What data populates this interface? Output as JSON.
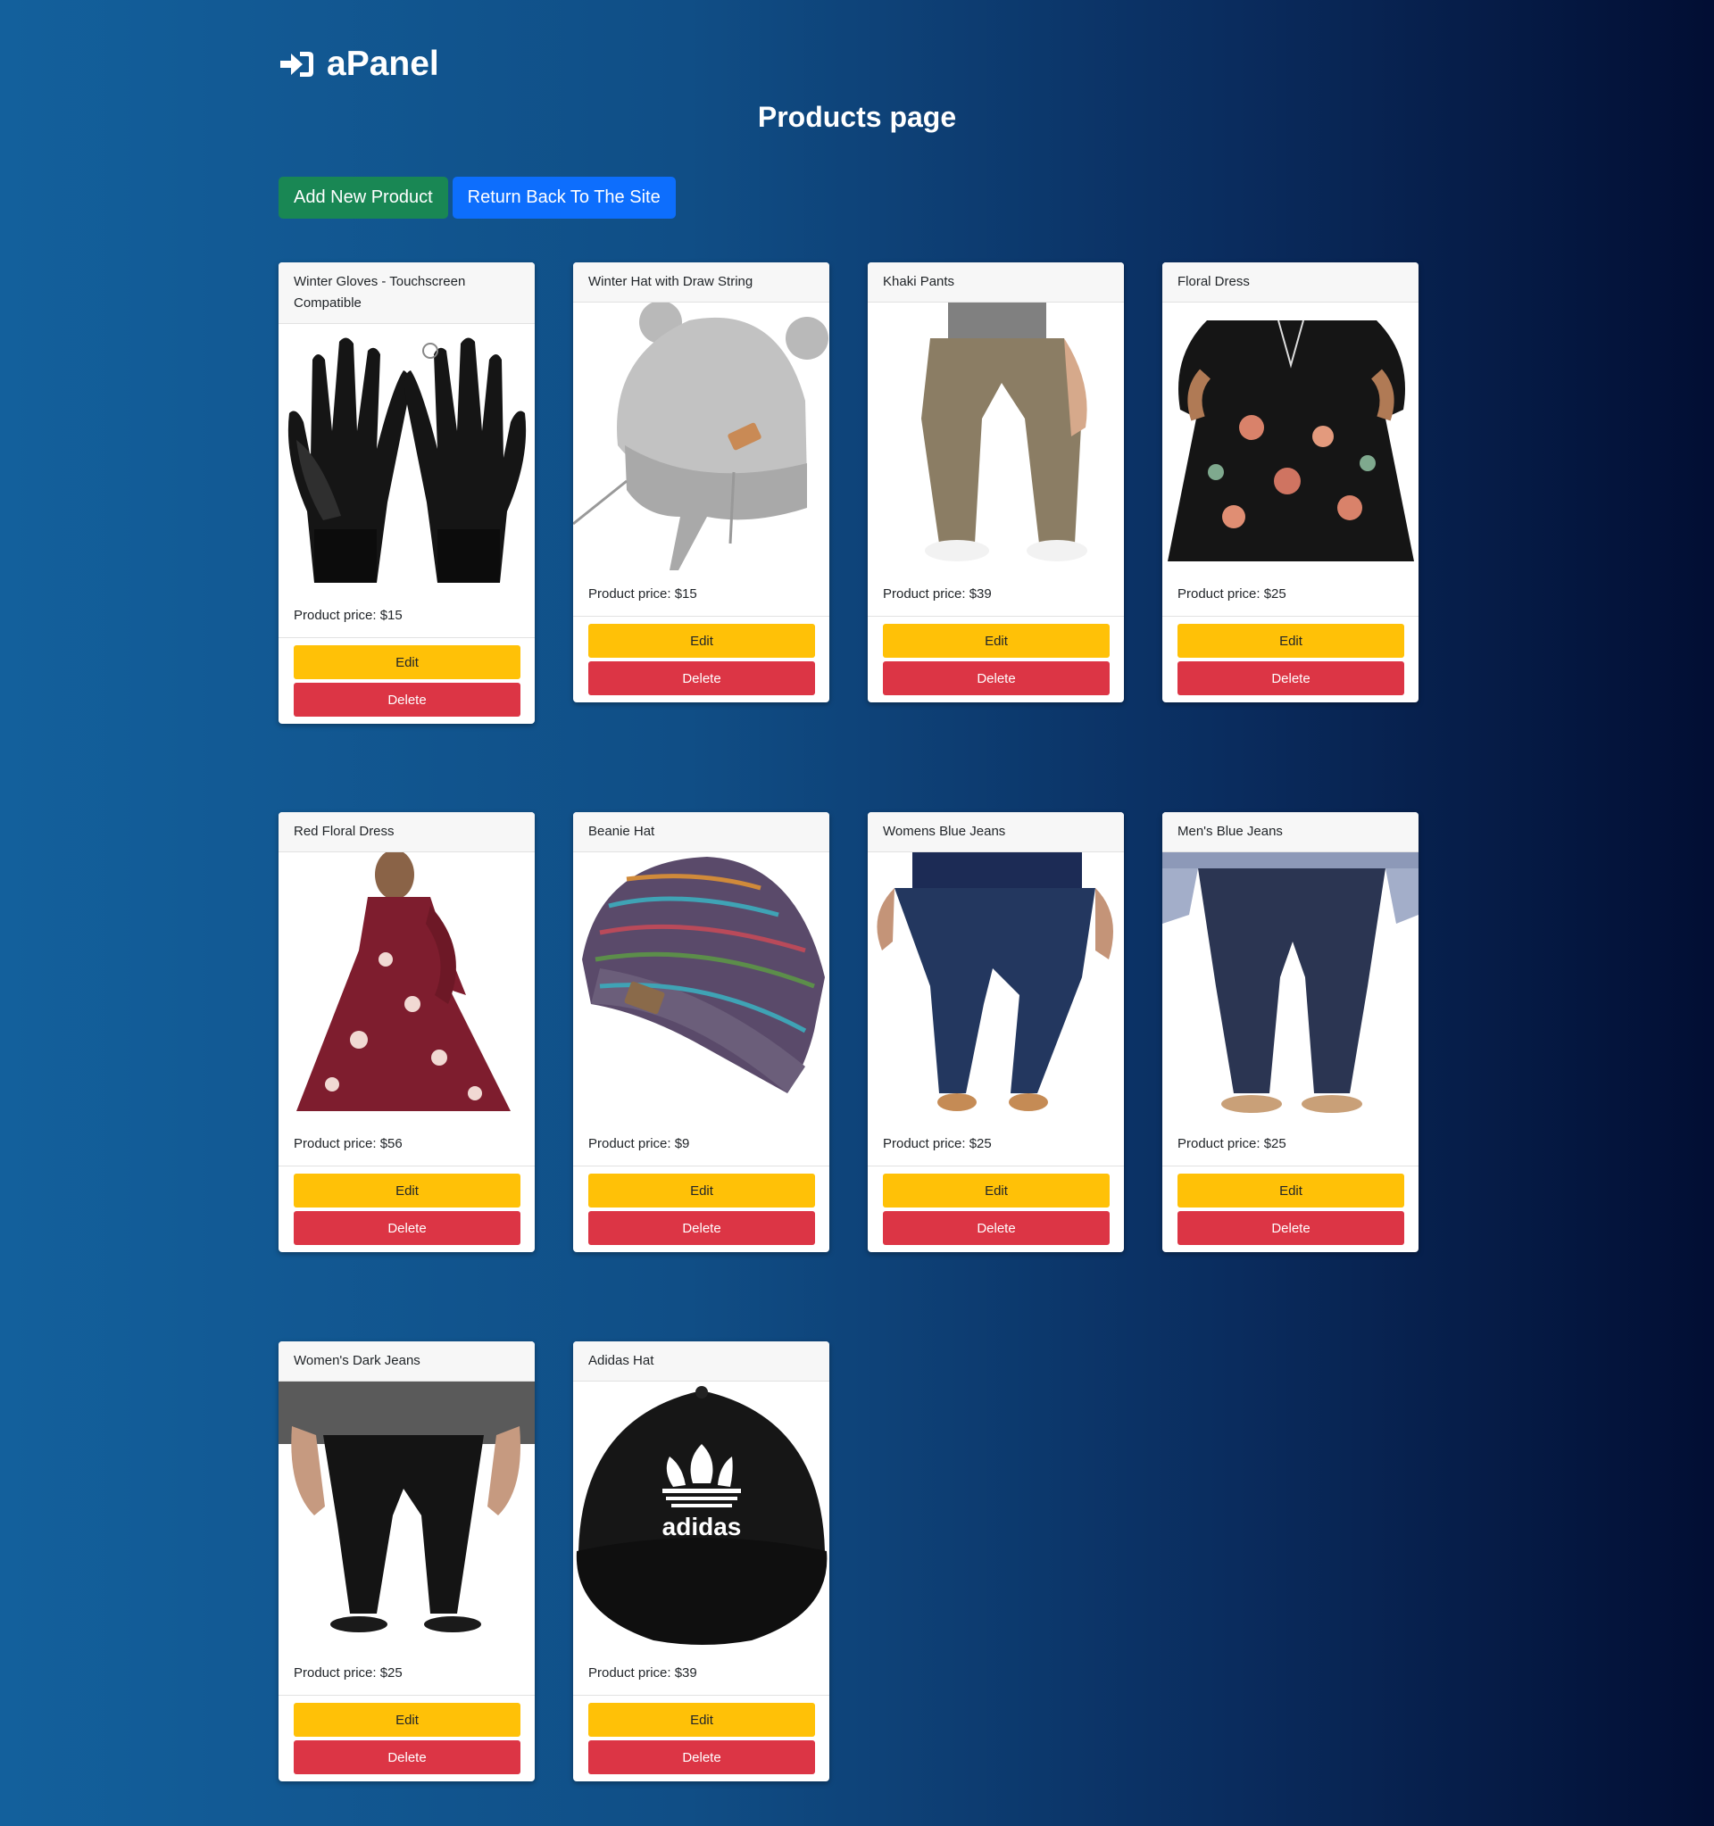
{
  "brand": {
    "icon": "sign-in-icon",
    "name": "aPanel"
  },
  "page": {
    "title": "Products page"
  },
  "toolbar": {
    "add_label": "Add New Product",
    "return_label": "Return Back To The Site"
  },
  "colors": {
    "add": "#198754",
    "return": "#0d6efd",
    "edit": "#ffc107",
    "delete": "#dc3545"
  },
  "products": [
    {
      "name": "Winter Gloves - Touchscreen Compatible",
      "price": "Product price: $15",
      "edit": "Edit",
      "delete": "Delete",
      "image": "black-winter-gloves"
    },
    {
      "name": "Winter Hat with Draw String",
      "price": "Product price: $15",
      "edit": "Edit",
      "delete": "Delete",
      "image": "grey-knit-hat"
    },
    {
      "name": "Khaki Pants",
      "price": "Product price: $39",
      "edit": "Edit",
      "delete": "Delete",
      "image": "khaki-pants"
    },
    {
      "name": "Floral Dress",
      "price": "Product price: $25",
      "edit": "Edit",
      "delete": "Delete",
      "image": "black-floral-dress"
    },
    {
      "name": "Red Floral Dress",
      "price": "Product price: $56",
      "edit": "Edit",
      "delete": "Delete",
      "image": "red-floral-dress"
    },
    {
      "name": "Beanie Hat",
      "price": "Product price: $9",
      "edit": "Edit",
      "delete": "Delete",
      "image": "multicolor-beanie"
    },
    {
      "name": "Womens Blue Jeans",
      "price": "Product price: $25",
      "edit": "Edit",
      "delete": "Delete",
      "image": "womens-blue-jeans"
    },
    {
      "name": "Men's Blue Jeans",
      "price": "Product price: $25",
      "edit": "Edit",
      "delete": "Delete",
      "image": "mens-blue-pants"
    },
    {
      "name": "Women's Dark Jeans",
      "price": "Product price: $25",
      "edit": "Edit",
      "delete": "Delete",
      "image": "black-jeans"
    },
    {
      "name": "Adidas Hat",
      "price": "Product price: $39",
      "edit": "Edit",
      "delete": "Delete",
      "image": "adidas-cap",
      "logo_text": "adidas"
    }
  ]
}
